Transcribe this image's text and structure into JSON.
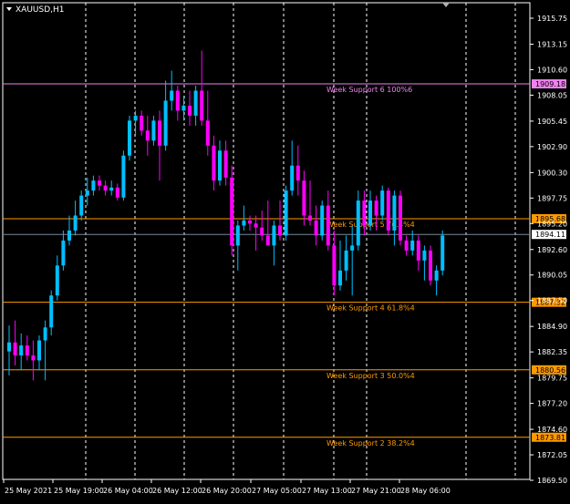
{
  "window": {
    "symbol_title": "XAUUSD,H1",
    "menu_icon": "triangle-down-icon",
    "shift_marker_icon": "triangle-down-icon"
  },
  "colors": {
    "background": "#000000",
    "frame": "#ffffff",
    "bull_candle": "#00bfff",
    "bear_candle": "#ff00ff",
    "grid": "#ffffff",
    "support_orange": "#ff9900",
    "support6_violet": "#ee82ee",
    "bid_line": "#778899",
    "axis_text": "#ffffff"
  },
  "chart_data": {
    "type": "candlestick",
    "symbol": "XAUUSD",
    "timeframe": "H1",
    "ylim": [
      1868.5,
      1917.5
    ],
    "y_ticks": [
      "1915.75",
      "1913.15",
      "1910.60",
      "1908.05",
      "1905.45",
      "1902.90",
      "1900.30",
      "1897.75",
      "1895.20",
      "1892.60",
      "1890.05",
      "1887.50",
      "1884.90",
      "1882.35",
      "1879.75",
      "1877.20",
      "1874.60",
      "1872.05",
      "1869.50"
    ],
    "x_labels": [
      "25 May 2021",
      "25 May 19:00",
      "26 May 04:00",
      "26 May 12:00",
      "26 May 20:00",
      "27 May 05:00",
      "27 May 13:00",
      "27 May 21:00",
      "28 May 06:00"
    ],
    "support_levels": [
      {
        "label": "Week Support 6 100%6",
        "price": 1909.18,
        "price_label": "1909.18",
        "color": "#ee82ee"
      },
      {
        "label": "Week Support 5 76.4%4",
        "price": 1895.68,
        "price_label": "1895.68",
        "color": "#ff9900"
      },
      {
        "label": "Week Support 4 61.8%4",
        "price": 1887.32,
        "price_label": "1887.32",
        "color": "#ff9900"
      },
      {
        "label": "Week Support 3 50.0%4",
        "price": 1880.56,
        "price_label": "1880.56",
        "color": "#ff9900"
      },
      {
        "label": "Week Support 2 38.2%4",
        "price": 1873.81,
        "price_label": "1873.81",
        "color": "#ff9900"
      }
    ],
    "bid": {
      "price": 1894.11,
      "label": "1894.11"
    },
    "candles": [
      [
        1882.4,
        1885.0,
        1880.0,
        1883.3
      ],
      [
        1883.3,
        1885.5,
        1881.0,
        1882.0
      ],
      [
        1882.0,
        1884.2,
        1880.5,
        1883.0
      ],
      [
        1883.0,
        1884.0,
        1881.5,
        1882.0
      ],
      [
        1882.0,
        1883.5,
        1879.5,
        1881.5
      ],
      [
        1881.5,
        1884.0,
        1880.5,
        1883.5
      ],
      [
        1883.5,
        1885.5,
        1879.5,
        1884.8
      ],
      [
        1884.8,
        1888.5,
        1884.0,
        1888.0
      ],
      [
        1888.0,
        1892.0,
        1887.5,
        1891.0
      ],
      [
        1891.0,
        1894.5,
        1890.5,
        1893.5
      ],
      [
        1893.5,
        1896.0,
        1893.0,
        1894.5
      ],
      [
        1894.5,
        1897.5,
        1894.0,
        1896.0
      ],
      [
        1896.0,
        1898.5,
        1895.5,
        1898.0
      ],
      [
        1898.0,
        1899.8,
        1897.0,
        1898.5
      ],
      [
        1898.5,
        1900.0,
        1898.0,
        1899.5
      ],
      [
        1899.5,
        1900.0,
        1898.5,
        1899.0
      ],
      [
        1899.0,
        1899.5,
        1898.0,
        1898.5
      ],
      [
        1898.5,
        1899.5,
        1898.0,
        1898.8
      ],
      [
        1898.8,
        1899.2,
        1897.5,
        1897.8
      ],
      [
        1897.8,
        1902.5,
        1897.5,
        1902.0
      ],
      [
        1902.0,
        1906.0,
        1901.5,
        1905.5
      ],
      [
        1905.5,
        1906.5,
        1904.0,
        1906.0
      ],
      [
        1906.0,
        1906.5,
        1904.0,
        1904.5
      ],
      [
        1904.5,
        1906.0,
        1902.0,
        1903.5
      ],
      [
        1903.5,
        1906.0,
        1903.0,
        1905.5
      ],
      [
        1905.5,
        1906.5,
        1899.5,
        1903.0
      ],
      [
        1903.0,
        1909.5,
        1902.5,
        1907.5
      ],
      [
        1907.5,
        1910.5,
        1906.5,
        1908.5
      ],
      [
        1908.5,
        1909.0,
        1905.5,
        1906.5
      ],
      [
        1906.5,
        1908.0,
        1905.5,
        1907.0
      ],
      [
        1907.0,
        1908.5,
        1905.0,
        1906.0
      ],
      [
        1906.0,
        1909.0,
        1905.0,
        1908.5
      ],
      [
        1908.5,
        1912.5,
        1905.0,
        1905.5
      ],
      [
        1905.5,
        1908.5,
        1902.0,
        1903.0
      ],
      [
        1903.0,
        1904.0,
        1898.5,
        1899.5
      ],
      [
        1899.5,
        1903.5,
        1899.0,
        1902.5
      ],
      [
        1902.5,
        1903.5,
        1899.0,
        1899.8
      ],
      [
        1899.8,
        1901.0,
        1892.0,
        1893.0
      ],
      [
        1893.0,
        1895.5,
        1890.5,
        1895.0
      ],
      [
        1895.0,
        1897.0,
        1894.5,
        1895.5
      ],
      [
        1895.5,
        1896.0,
        1894.5,
        1895.2
      ],
      [
        1895.2,
        1896.0,
        1892.5,
        1894.8
      ],
      [
        1894.8,
        1896.5,
        1893.5,
        1894.0
      ],
      [
        1894.0,
        1897.5,
        1893.0,
        1893.0
      ],
      [
        1893.0,
        1895.5,
        1891.0,
        1895.0
      ],
      [
        1895.0,
        1897.5,
        1893.5,
        1894.0
      ],
      [
        1894.0,
        1899.0,
        1893.5,
        1898.5
      ],
      [
        1898.5,
        1903.5,
        1898.0,
        1901.0
      ],
      [
        1901.0,
        1903.0,
        1898.0,
        1899.5
      ],
      [
        1899.5,
        1900.5,
        1895.0,
        1896.0
      ],
      [
        1896.0,
        1899.5,
        1895.0,
        1895.5
      ],
      [
        1895.5,
        1897.0,
        1893.0,
        1894.0
      ],
      [
        1894.0,
        1897.5,
        1893.5,
        1897.0
      ],
      [
        1897.0,
        1898.5,
        1892.5,
        1893.0
      ],
      [
        1893.0,
        1894.5,
        1888.0,
        1889.0
      ],
      [
        1889.0,
        1893.5,
        1888.5,
        1890.5
      ],
      [
        1890.5,
        1894.0,
        1889.5,
        1892.5
      ],
      [
        1892.5,
        1895.0,
        1888.0,
        1893.0
      ],
      [
        1893.0,
        1898.5,
        1892.5,
        1897.5
      ],
      [
        1897.5,
        1898.5,
        1894.0,
        1895.0
      ],
      [
        1895.0,
        1898.5,
        1894.5,
        1897.5
      ],
      [
        1897.5,
        1898.0,
        1894.5,
        1896.0
      ],
      [
        1896.0,
        1899.0,
        1895.5,
        1898.5
      ],
      [
        1898.5,
        1898.8,
        1894.0,
        1894.5
      ],
      [
        1894.5,
        1898.5,
        1893.0,
        1898.0
      ],
      [
        1898.0,
        1898.5,
        1893.0,
        1893.5
      ],
      [
        1893.5,
        1894.0,
        1892.0,
        1892.5
      ],
      [
        1892.5,
        1894.5,
        1892.0,
        1893.5
      ],
      [
        1893.5,
        1894.0,
        1890.5,
        1891.5
      ],
      [
        1891.5,
        1893.0,
        1889.5,
        1892.5
      ],
      [
        1892.5,
        1893.0,
        1889.0,
        1889.5
      ],
      [
        1889.5,
        1891.0,
        1888.0,
        1890.5
      ],
      [
        1890.5,
        1894.5,
        1890.0,
        1894.0
      ]
    ]
  }
}
